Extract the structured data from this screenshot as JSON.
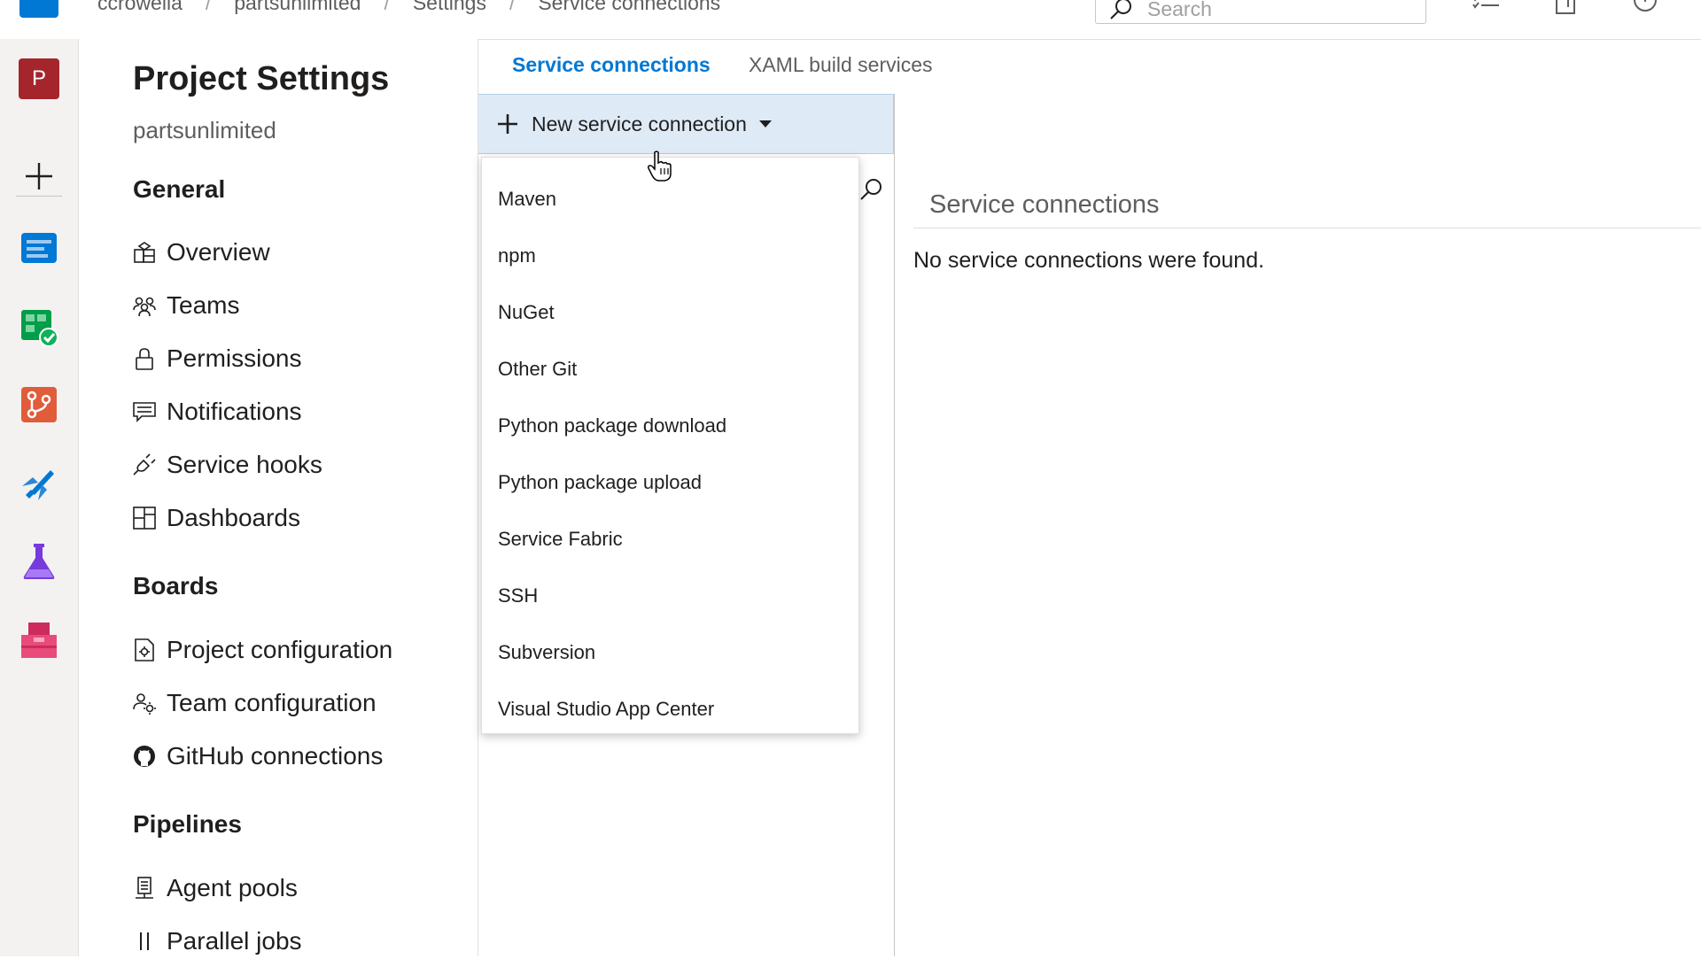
{
  "breadcrumb": [
    "ccrowella",
    "partsunlimited",
    "Settings",
    "Service connections"
  ],
  "search": {
    "placeholder": "Search"
  },
  "rail": {
    "project_initial": "P",
    "items": [
      {
        "icon": "plus-icon"
      },
      {
        "icon": "overview-icon",
        "color": "#0078d4"
      },
      {
        "icon": "boards-icon",
        "color": "#009e49"
      },
      {
        "icon": "repos-icon",
        "color": "#e05c3a"
      },
      {
        "icon": "pipelines-icon",
        "color": "#0078d4"
      },
      {
        "icon": "test-plans-icon",
        "color": "#773adc"
      },
      {
        "icon": "artifacts-icon",
        "color": "#cc2b5e"
      }
    ]
  },
  "settings_nav": {
    "title": "Project Settings",
    "project": "partsunlimited",
    "sections": [
      {
        "label": "General",
        "items": [
          {
            "label": "Overview",
            "icon": "overview-icon"
          },
          {
            "label": "Teams",
            "icon": "teams-icon"
          },
          {
            "label": "Permissions",
            "icon": "lock-icon"
          },
          {
            "label": "Notifications",
            "icon": "chat-icon"
          },
          {
            "label": "Service hooks",
            "icon": "plug-icon"
          },
          {
            "label": "Dashboards",
            "icon": "dashboard-icon"
          }
        ]
      },
      {
        "label": "Boards",
        "items": [
          {
            "label": "Project configuration",
            "icon": "config-doc-icon"
          },
          {
            "label": "Team configuration",
            "icon": "team-config-icon"
          },
          {
            "label": "GitHub connections",
            "icon": "github-icon"
          }
        ]
      },
      {
        "label": "Pipelines",
        "items": [
          {
            "label": "Agent pools",
            "icon": "agent-pool-icon"
          },
          {
            "label": "Parallel jobs",
            "icon": "parallel-icon"
          }
        ]
      }
    ]
  },
  "tabs": [
    {
      "label": "Service connections",
      "active": true
    },
    {
      "label": "XAML build services",
      "active": false
    }
  ],
  "new_connection": {
    "label": "New service connection"
  },
  "menu": {
    "items": [
      "Maven",
      "npm",
      "NuGet",
      "Other Git",
      "Python package download",
      "Python package upload",
      "Service Fabric",
      "SSH",
      "Subversion",
      "Visual Studio App Center"
    ]
  },
  "content": {
    "title": "Service connections",
    "empty_message": "No service connections were found."
  },
  "colors": {
    "accent": "#0078d4",
    "project_avatar": "#a4262c",
    "button_bg": "#dfeaf7"
  }
}
